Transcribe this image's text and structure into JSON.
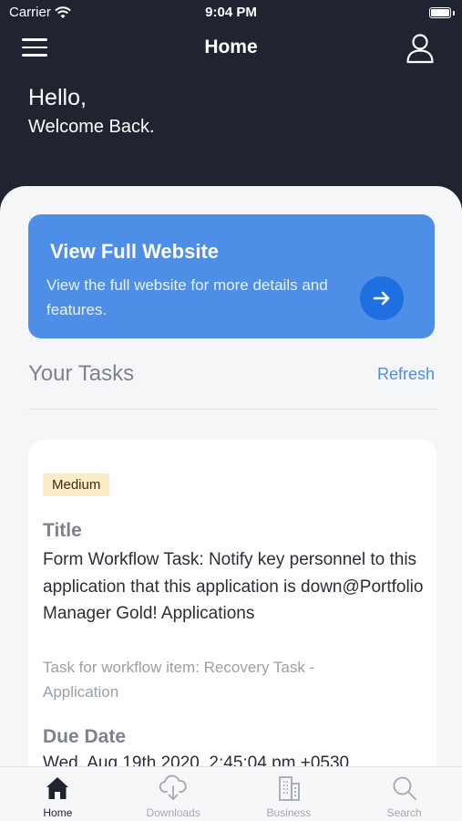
{
  "status_bar": {
    "carrier": "Carrier",
    "time": "9:04 PM"
  },
  "header": {
    "title": "Home"
  },
  "greeting": {
    "hello": "Hello,",
    "welcome": "Welcome Back."
  },
  "promo": {
    "title": "View Full Website",
    "text": "View the full website for more details and features."
  },
  "tasks": {
    "title": "Your Tasks",
    "refresh_label": "Refresh",
    "items": [
      {
        "priority": "Medium",
        "title_label": "Title",
        "title": "Form Workflow Task: Notify key personnel to this application that this application is down@Portfolio Manager Gold! Applications",
        "description": "Task for workflow item: Recovery Task - Application",
        "due_label": "Due Date",
        "due_date": "Wed, Aug 19th 2020, 2:45:04 pm +0530"
      }
    ]
  },
  "tab_bar": {
    "items": [
      {
        "label": "Home",
        "icon": "home-icon",
        "active": true
      },
      {
        "label": "Downloads",
        "icon": "cloud-download-icon",
        "active": false
      },
      {
        "label": "Business",
        "icon": "building-icon",
        "active": false
      },
      {
        "label": "Search",
        "icon": "search-icon",
        "active": false
      }
    ]
  },
  "colors": {
    "dark_bg": "#1f2430",
    "accent": "#4d8ee6",
    "badge_bg": "#fdecc8"
  }
}
